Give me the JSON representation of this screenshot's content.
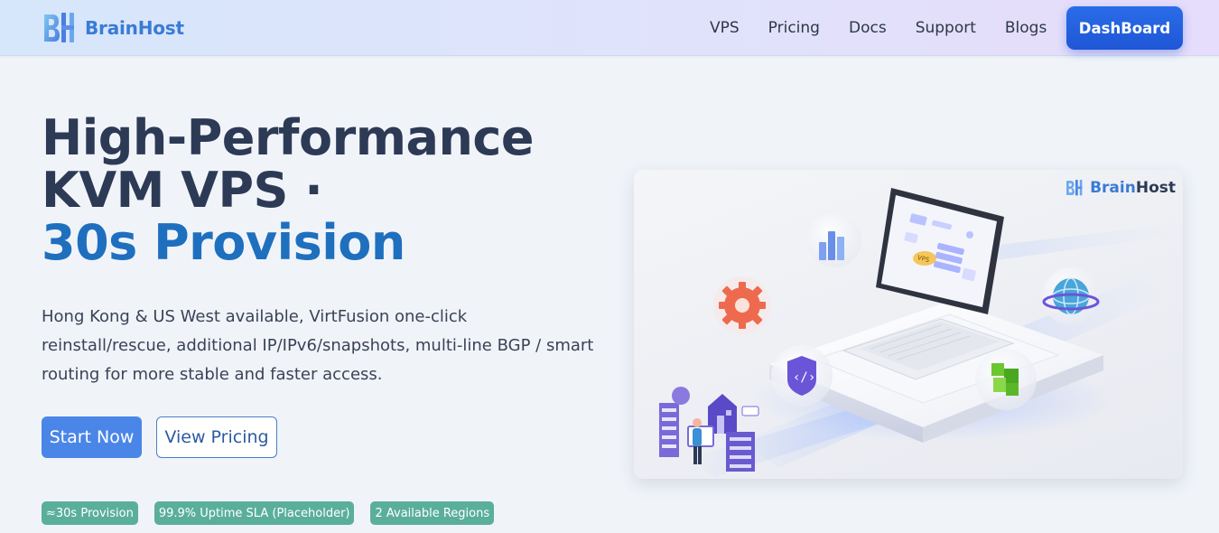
{
  "nav": {
    "brand": "BrainHost",
    "links": [
      {
        "label": "VPS"
      },
      {
        "label": "Pricing"
      },
      {
        "label": "Docs"
      },
      {
        "label": "Support"
      },
      {
        "label": "Blogs"
      }
    ],
    "dashboard_label": "DashBoard"
  },
  "hero": {
    "title_line1": "High-Performance",
    "title_line2": "KVM VPS ·",
    "title_line3": "30s Provision",
    "description": "Hong Kong & US West available, VirtFusion one-click reinstall/rescue, additional IP/IPv6/snapshots, multi-line BGP / smart routing for more stable and faster access.",
    "primary_button": "Start Now",
    "secondary_button": "View Pricing",
    "badges": [
      {
        "label": "≈30s Provision"
      },
      {
        "label": "99.9% Uptime SLA (Placeholder)"
      },
      {
        "label": "2 Available Regions"
      }
    ]
  },
  "illustration": {
    "brand_prefix": "Brain",
    "brand_suffix": "Host",
    "screen_label": "VPS"
  },
  "colors": {
    "accent": "#1f6fbf",
    "primary_button": "#4a86e8",
    "dashboard_button": "#1f56d6",
    "badge": "#5aaf9b",
    "title": "#2d3a55"
  }
}
